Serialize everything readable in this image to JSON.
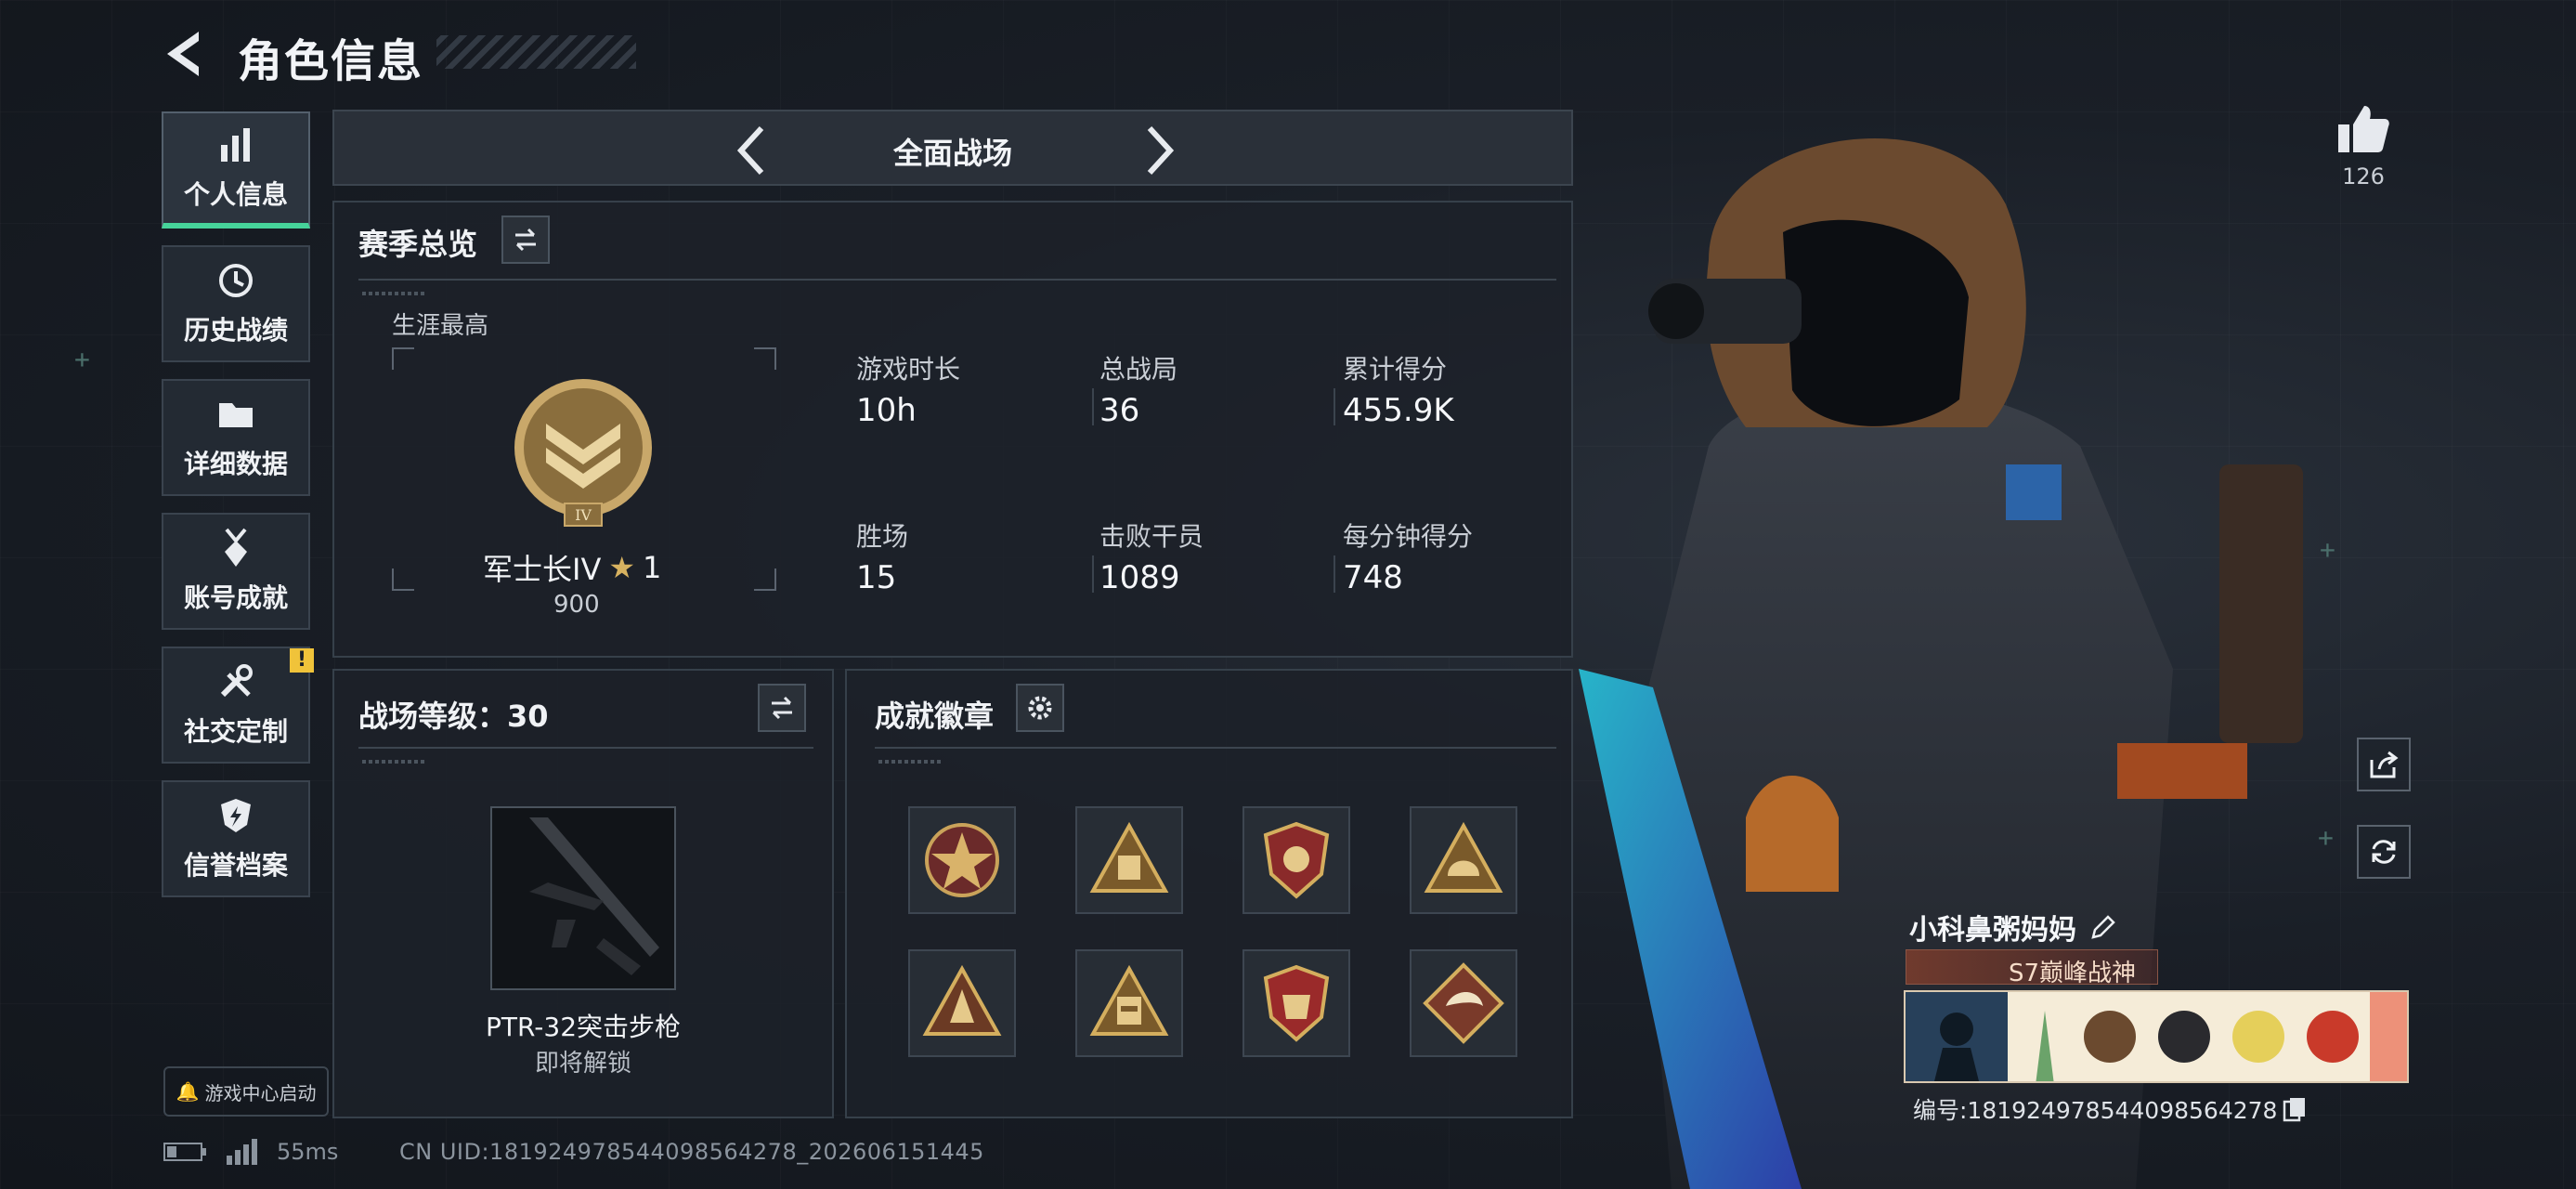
{
  "header": {
    "title": "角色信息"
  },
  "sidebar": {
    "items": [
      {
        "label": "个人信息",
        "icon": "bar-chart-icon",
        "active": true
      },
      {
        "label": "历史战绩",
        "icon": "history-clock-icon",
        "active": false
      },
      {
        "label": "详细数据",
        "icon": "folder-icon",
        "active": false
      },
      {
        "label": "账号成就",
        "icon": "medal-icon",
        "active": false
      },
      {
        "label": "社交定制",
        "icon": "tools-icon",
        "active": false,
        "badge": "!"
      },
      {
        "label": "信誉档案",
        "icon": "shield-lightning-icon",
        "active": false
      }
    ],
    "game_center": "游戏中心启动"
  },
  "mode_bar": {
    "label": "全面战场"
  },
  "season": {
    "title": "赛季总览",
    "career_label": "生涯最高",
    "rank_name": "军士长IV",
    "rank_stars": "1",
    "rank_points": "900",
    "stats": [
      {
        "label": "游戏时长",
        "value": "10h"
      },
      {
        "label": "总战局",
        "value": "36"
      },
      {
        "label": "累计得分",
        "value": "455.9K"
      },
      {
        "label": "胜场",
        "value": "15"
      },
      {
        "label": "击败干员",
        "value": "1089"
      },
      {
        "label": "每分钟得分",
        "value": "748"
      }
    ]
  },
  "battlefield_level": {
    "title": "战场等级：30",
    "weapon_name": "PTR-32突击步枪",
    "weapon_status": "即将解锁"
  },
  "achievements": {
    "title": "成就徽章",
    "badges": [
      "star-badge-icon",
      "ammo-badge-icon",
      "shield-badge-icon",
      "helmet-badge-icon",
      "triangle-badge-icon",
      "crate-badge-icon",
      "crest-badge-icon",
      "dragon-badge-icon"
    ]
  },
  "profile": {
    "likes": "126",
    "player_name": "小科鼻粥妈妈",
    "title_badge": "S7巅峰战神",
    "player_id": "编号:181924978544098564278"
  },
  "status_bar": {
    "ping": "55ms",
    "uid": "CN UID:181924978544098564278_202606151445"
  },
  "colors": {
    "accent_green": "#46d39a",
    "warning_yellow": "#f0c33a",
    "panel_bg": "#1c2129"
  }
}
